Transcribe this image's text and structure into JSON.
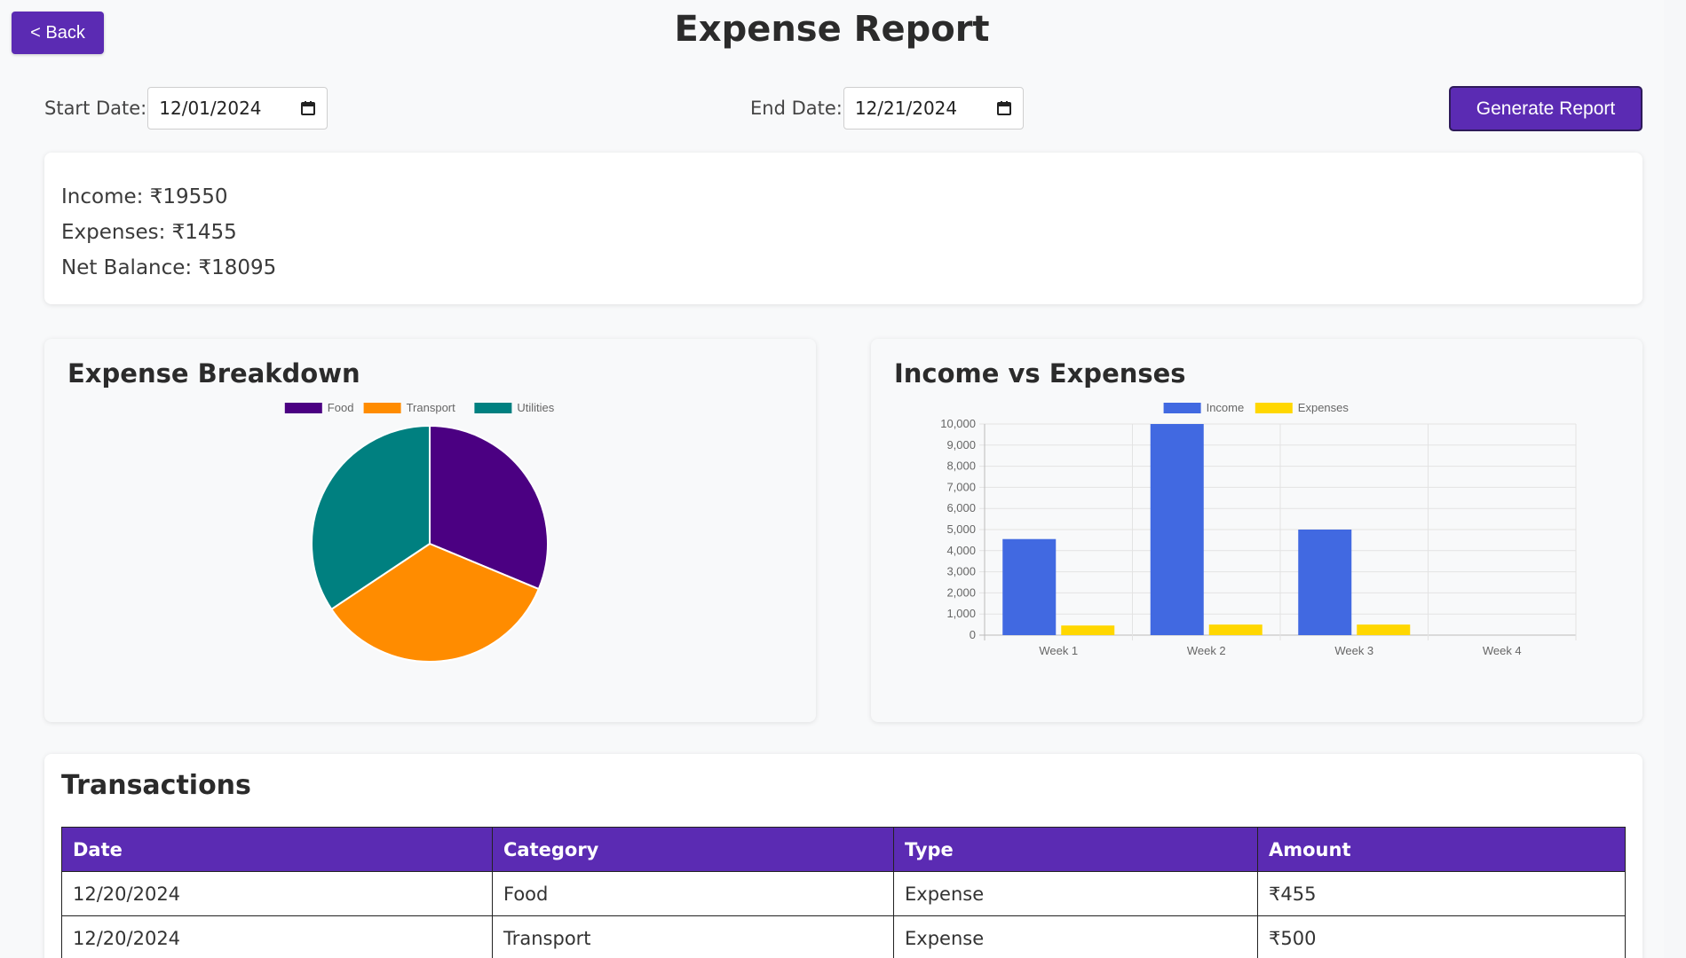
{
  "header": {
    "back_label": "< Back",
    "title": "Expense Report"
  },
  "filters": {
    "start_label": "Start Date:",
    "start_value": "12/01/2024",
    "end_label": "End Date:",
    "end_value": "12/21/2024",
    "generate_label": "Generate Report"
  },
  "summary": {
    "income": "Income: ₹19550",
    "expenses": "Expenses: ₹1455",
    "net": "Net Balance: ₹18095"
  },
  "colors": {
    "accent": "#5b2bb3",
    "food": "#4b0082",
    "transport": "#ff8c00",
    "utilities": "#008080",
    "income": "#4169e1",
    "expenses": "#ffd700"
  },
  "chart_data": [
    {
      "type": "pie",
      "title": "Expense Breakdown",
      "legend_position": "top",
      "categories": [
        "Food",
        "Transport",
        "Utilities"
      ],
      "values": [
        455,
        500,
        500
      ],
      "colors": [
        "#4b0082",
        "#ff8c00",
        "#008080"
      ]
    },
    {
      "type": "bar",
      "title": "Income vs Expenses",
      "legend_position": "top",
      "categories": [
        "Week 1",
        "Week 2",
        "Week 3",
        "Week 4"
      ],
      "series": [
        {
          "name": "Income",
          "values": [
            4550,
            10000,
            5000,
            0
          ],
          "color": "#4169e1"
        },
        {
          "name": "Expenses",
          "values": [
            455,
            500,
            500,
            0
          ],
          "color": "#ffd700"
        }
      ],
      "ylim": [
        0,
        10000
      ],
      "yticks": [
        "0",
        "1,000",
        "2,000",
        "3,000",
        "4,000",
        "5,000",
        "6,000",
        "7,000",
        "8,000",
        "9,000",
        "10,000"
      ],
      "grid": true
    }
  ],
  "transactions": {
    "title": "Transactions",
    "columns": [
      "Date",
      "Category",
      "Type",
      "Amount"
    ],
    "rows": [
      [
        "12/20/2024",
        "Food",
        "Expense",
        "₹455"
      ],
      [
        "12/20/2024",
        "Transport",
        "Expense",
        "₹500"
      ]
    ]
  }
}
